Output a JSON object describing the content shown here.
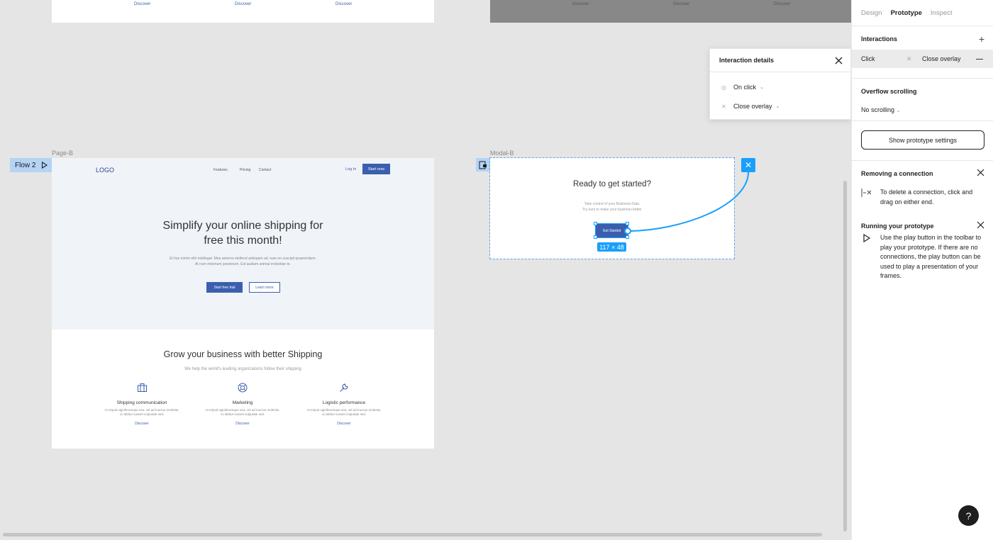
{
  "canvas": {
    "top_links_left": [
      "Discover",
      "Discover",
      "Discover"
    ],
    "top_links_right": [
      "Discover",
      "Discover",
      "Discover"
    ],
    "flow_tag": "Flow 2",
    "page_b": {
      "label": "Page-B",
      "logo": "LOGO",
      "nav": [
        "Features",
        "Pricing",
        "Contact"
      ],
      "login": "Log In",
      "start_now": "Start now",
      "hero_title_line1": "Simplify your online shipping for",
      "hero_title_line2": "free this month!",
      "hero_sub_line1": "Et has minim elitr intellegat. Mea aeterno eleifend antiopam ad, nam no suscipit quaerendum.",
      "hero_sub_line2": "At nam minimum ponderum. Est audiam animal molestiae te.",
      "btn_trial": "Start free trial",
      "btn_learn": "Learn more",
      "grow_title": "Grow your business with better Shipping",
      "grow_sub": "We help the world's leading organizations follow their shipping",
      "features": [
        {
          "title": "Shipping communication",
          "desc_line1": "At eripuit signiferumque sea, vel ad mucius molestie,",
          "desc_line2": "cu labitur iuvaret vulputate sed.",
          "link": "Discover",
          "icon": "briefcase-icon"
        },
        {
          "title": "Marketing",
          "desc_line1": "At eripuit signiferumque sea, vel ad mucius molestie,",
          "desc_line2": "cu labitur iuvaret vulputate sed.",
          "link": "Discover",
          "icon": "lifebuoy-icon"
        },
        {
          "title": "Logistic performance",
          "desc_line1": "At eripuit signiferumque sea, vel ad mucius molestie,",
          "desc_line2": "cu labitur iuvaret vulputate sed.",
          "link": "Discover",
          "icon": "wrench-icon"
        }
      ]
    },
    "modal_b": {
      "label": "Modal-B",
      "title": "Ready to get started?",
      "sub_line1": "Take control of your Business Data.",
      "sub_line2": "Try ours to make your business better",
      "button": "Get Started",
      "dimensions": "117 × 48"
    },
    "interaction_details": {
      "title": "Interaction details",
      "trigger": "On click",
      "action": "Close overlay"
    }
  },
  "panel": {
    "tabs": [
      "Design",
      "Prototype",
      "Inspect"
    ],
    "active_tab": "Prototype",
    "interactions_title": "Interactions",
    "interaction": {
      "trigger": "Click",
      "action": "Close overlay"
    },
    "overflow_title": "Overflow scrolling",
    "overflow_value": "No scrolling",
    "proto_settings_button": "Show prototype settings",
    "removing_title": "Removing a connection",
    "removing_text": "To delete a connection, click and drag on either end.",
    "running_title": "Running your prototype",
    "running_text": "Use the play button in the toolbar to play your prototype. If there are no connections, the play button can be used to play a presentation of your frames.",
    "help": "?"
  },
  "colors": {
    "accent": "#18a0fb",
    "brand_blue": "#3b5fae",
    "flow_tag_bg": "#b4d3f5"
  }
}
